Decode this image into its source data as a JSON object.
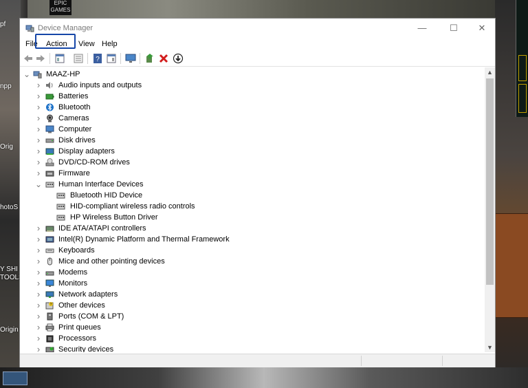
{
  "window": {
    "title": "Device Manager",
    "controls": {
      "minimize": "—",
      "maximize": "☐",
      "close": "✕"
    }
  },
  "menu": [
    "File",
    "Action",
    "View",
    "Help"
  ],
  "highlight": {
    "item": "Action",
    "color": "#1546a8"
  },
  "toolbar": [
    "back-icon",
    "forward-icon",
    "properties-icon",
    "details-icon",
    "help-icon",
    "view-icon",
    "monitor-icon",
    "update-driver-icon",
    "uninstall-icon",
    "scan-icon"
  ],
  "tree": {
    "root": "MAAZ-HP",
    "items": [
      {
        "label": "Audio inputs and outputs",
        "icon": "speaker-icon",
        "expanded": false
      },
      {
        "label": "Batteries",
        "icon": "battery-icon",
        "expanded": false
      },
      {
        "label": "Bluetooth",
        "icon": "bluetooth-icon",
        "expanded": false
      },
      {
        "label": "Cameras",
        "icon": "camera-icon",
        "expanded": false
      },
      {
        "label": "Computer",
        "icon": "computer-icon",
        "expanded": false
      },
      {
        "label": "Disk drives",
        "icon": "disk-icon",
        "expanded": false
      },
      {
        "label": "Display adapters",
        "icon": "display-icon",
        "expanded": false
      },
      {
        "label": "DVD/CD-ROM drives",
        "icon": "dvd-icon",
        "expanded": false
      },
      {
        "label": "Firmware",
        "icon": "firmware-icon",
        "expanded": false
      },
      {
        "label": "Human Interface Devices",
        "icon": "hid-icon",
        "expanded": true,
        "children": [
          "Bluetooth HID Device",
          "HID-compliant wireless radio controls",
          "HP Wireless Button Driver"
        ]
      },
      {
        "label": "IDE ATA/ATAPI controllers",
        "icon": "ide-icon",
        "expanded": false
      },
      {
        "label": "Intel(R) Dynamic Platform and Thermal Framework",
        "icon": "chip-icon",
        "expanded": false
      },
      {
        "label": "Keyboards",
        "icon": "keyboard-icon",
        "expanded": false
      },
      {
        "label": "Mice and other pointing devices",
        "icon": "mouse-icon",
        "expanded": false
      },
      {
        "label": "Modems",
        "icon": "modem-icon",
        "expanded": false
      },
      {
        "label": "Monitors",
        "icon": "monitor-icon",
        "expanded": false
      },
      {
        "label": "Network adapters",
        "icon": "network-icon",
        "expanded": false
      },
      {
        "label": "Other devices",
        "icon": "unknown-device-icon",
        "expanded": false
      },
      {
        "label": "Ports (COM & LPT)",
        "icon": "port-icon",
        "expanded": false
      },
      {
        "label": "Print queues",
        "icon": "printer-icon",
        "expanded": false
      },
      {
        "label": "Processors",
        "icon": "processor-icon",
        "expanded": false
      },
      {
        "label": "Security devices",
        "icon": "security-icon",
        "expanded": false
      }
    ]
  },
  "desktop": {
    "labels": [
      "pf",
      "npp",
      "Orig",
      "hotoS",
      "Y SHI",
      "TOOLS",
      "Origin"
    ],
    "game_badge": "EPIC GAMES"
  }
}
